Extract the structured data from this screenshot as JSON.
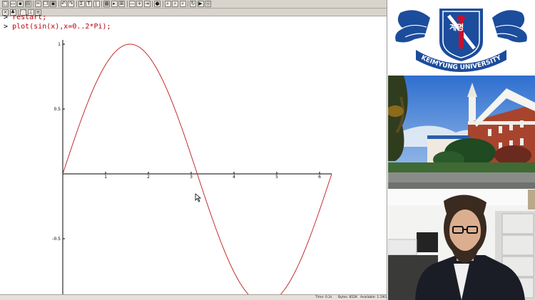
{
  "toolbar_row1": [
    {
      "icon": "new-document-icon"
    },
    {
      "icon": "open-folder-icon"
    },
    {
      "icon": "save-icon"
    },
    {
      "icon": "print-icon"
    },
    {
      "icon": "cut-icon"
    },
    {
      "icon": "copy-icon"
    },
    {
      "icon": "paste-icon"
    },
    {
      "icon": "undo-icon"
    },
    {
      "icon": "redo-icon"
    },
    {
      "icon": "sigma-icon"
    },
    {
      "icon": "text-mode-icon"
    },
    {
      "icon": "insert-bracket-icon"
    },
    {
      "icon": "plot-icon"
    },
    {
      "icon": "section-icon"
    },
    {
      "icon": "table-icon"
    },
    {
      "icon": "collapse-icon"
    },
    {
      "icon": "expand-icon"
    },
    {
      "icon": "indent-icon"
    },
    {
      "icon": "stop-icon"
    },
    {
      "icon": "zoom-100-icon"
    },
    {
      "icon": "zoom-150-icon"
    },
    {
      "icon": "zoom-200-icon"
    },
    {
      "icon": "restart-icon"
    },
    {
      "icon": "execute-icon"
    },
    {
      "icon": "debug-icon"
    }
  ],
  "toolbar_row2": [
    {
      "icon": "close-icon"
    },
    {
      "icon": "tree-icon"
    },
    {
      "icon": "plot-style-icon"
    },
    {
      "icon": "axes-icon"
    },
    {
      "icon": "legend-icon"
    }
  ],
  "worksheet": {
    "line1": {
      "prompt": ">",
      "text": "restart;"
    },
    "line2": {
      "prompt": ">",
      "text": "plot(sin(x),x=0..2*Pi);"
    }
  },
  "chart_data": {
    "type": "line",
    "expression": "sin(x)",
    "title": "",
    "xlabel": "",
    "ylabel": "",
    "xlim": [
      0,
      6.2832
    ],
    "ylim": [
      -1,
      1
    ],
    "x_ticks": [
      "1",
      "2",
      "3",
      "4",
      "5",
      "6"
    ],
    "y_ticks": [
      "1",
      "0.5",
      "-0.5"
    ],
    "series": [
      {
        "name": "",
        "color": "#c01818",
        "x": [
          0,
          0.5236,
          1.0472,
          1.5708,
          2.0944,
          2.618,
          3.1416,
          3.6652,
          4.1888,
          4.7124,
          5.236,
          5.7596,
          6.2832
        ],
        "y": [
          0,
          0.5,
          0.866,
          1,
          0.866,
          0.5,
          0,
          -0.5,
          -0.866,
          -1,
          -0.866,
          -0.5,
          0
        ]
      }
    ],
    "grid": false,
    "axes_color": "#000000"
  },
  "status": {
    "time": "Time: 0.2s",
    "bytes": "Bytes: 852K",
    "available": "Available: 1.19G"
  },
  "colors": {
    "toolbar": "#d8d4cc",
    "input_text": "#b4000c",
    "logo_blue": "#1c4c9c"
  },
  "sidebar": {
    "logo_text": "KEIMYUNG UNIVERSITY",
    "logo_korean": "계명"
  }
}
